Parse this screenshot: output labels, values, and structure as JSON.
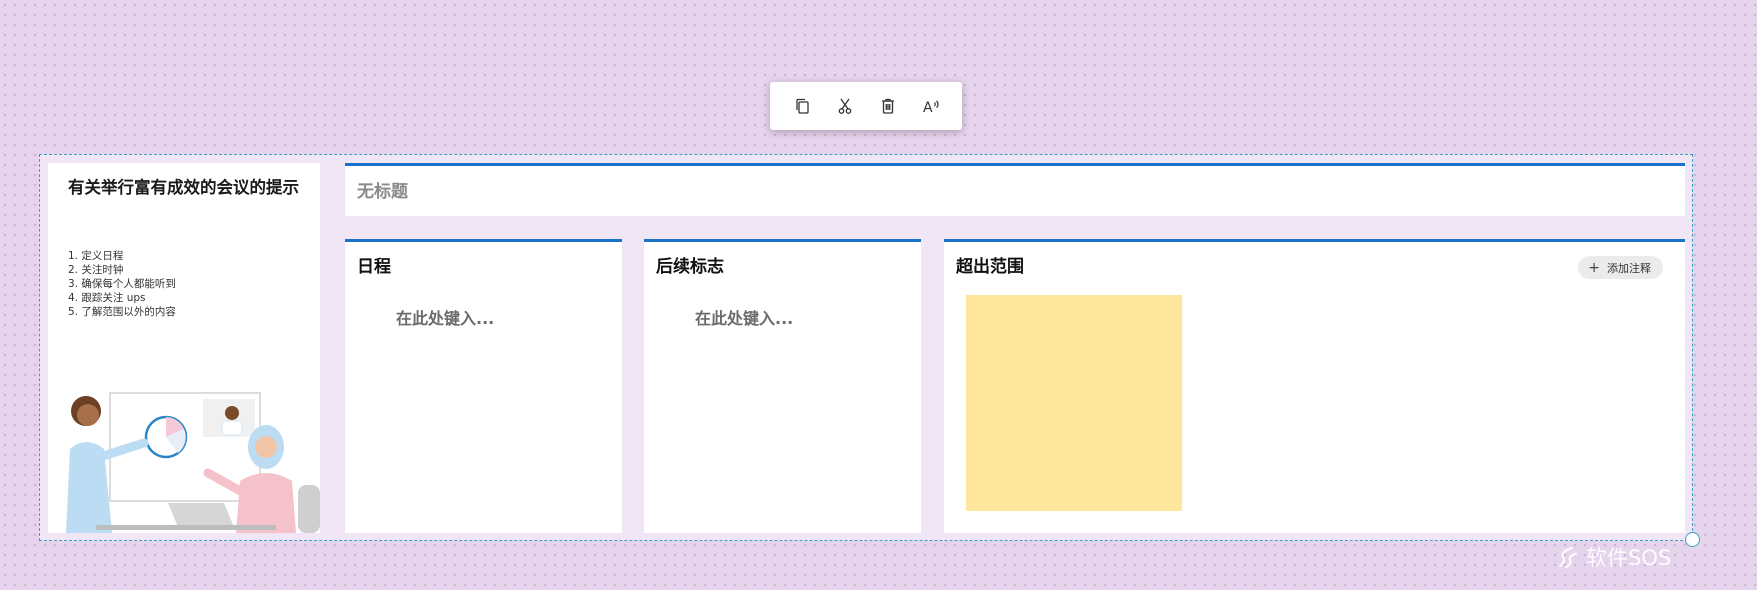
{
  "toolbar": {
    "buttons": [
      {
        "name": "copy",
        "icon": "copy-icon"
      },
      {
        "name": "cut",
        "icon": "scissors-icon"
      },
      {
        "name": "delete",
        "icon": "trash-icon"
      },
      {
        "name": "read-aloud",
        "icon": "read-aloud-icon",
        "label": "A"
      }
    ]
  },
  "tips": {
    "title": "有关举行富有成效的会议的提示",
    "items": [
      "1. 定义日程",
      "2. 关注时钟",
      "3. 确保每个人都能听到",
      "4. 跟踪关注 ups",
      "5. 了解范围以外的内容"
    ]
  },
  "titlebar": {
    "text": "无标题"
  },
  "columns": [
    {
      "title": "日程",
      "placeholder": "在此处键入..."
    },
    {
      "title": "后续标志",
      "placeholder": "在此处键入..."
    },
    {
      "title": "超出范围",
      "add_note": "添加注释"
    }
  ],
  "watermark": {
    "text": "软件SOS"
  },
  "colors": {
    "accent": "#1a73c8",
    "canvas": "#e6d3ec",
    "selection": "#3a9fc2",
    "sticky_note": "#fee69d"
  }
}
